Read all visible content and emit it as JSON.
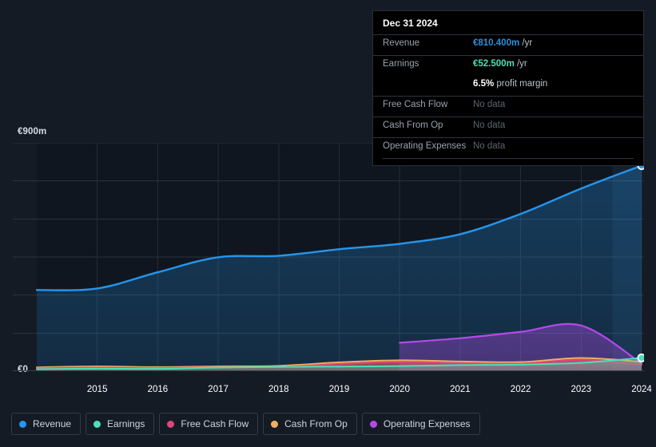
{
  "tooltip": {
    "date": "Dec 31 2024",
    "rows": [
      {
        "key": "Revenue",
        "value": "€810.400m",
        "unit": "/yr",
        "color": "#2d8fdd",
        "nodata": false
      },
      {
        "key": "Earnings",
        "value": "€52.500m",
        "unit": "/yr",
        "color": "#4ae0b8",
        "nodata": false
      },
      {
        "key": "",
        "value": "6.5%",
        "unit": "profit margin",
        "color": "#ffffff",
        "nodata": false
      },
      {
        "key": "Free Cash Flow",
        "value": "No data",
        "unit": "",
        "color": "#5d646e",
        "nodata": true
      },
      {
        "key": "Cash From Op",
        "value": "No data",
        "unit": "",
        "color": "#5d646e",
        "nodata": true
      },
      {
        "key": "Operating Expenses",
        "value": "No data",
        "unit": "",
        "color": "#5d646e",
        "nodata": true
      }
    ]
  },
  "axis": {
    "y_top_label": "€900m",
    "y_bottom_label": "€0"
  },
  "legend": [
    {
      "label": "Revenue",
      "color": "#2496ed"
    },
    {
      "label": "Earnings",
      "color": "#4ae0b8"
    },
    {
      "label": "Free Cash Flow",
      "color": "#e0457b"
    },
    {
      "label": "Cash From Op",
      "color": "#f0b05c"
    },
    {
      "label": "Operating Expenses",
      "color": "#b44ae8"
    }
  ],
  "chart_data": {
    "type": "area",
    "title": "",
    "xlabel": "",
    "ylabel": "",
    "currency": "EUR",
    "unit": "millions",
    "ylim": [
      0,
      900
    ],
    "ytick_labels": [
      "€0",
      "€900m"
    ],
    "grid": true,
    "legend_position": "bottom-left",
    "x": [
      2014.3,
      2015,
      2016,
      2017,
      2018,
      2019,
      2020,
      2021,
      2022,
      2023,
      2024
    ],
    "categories": [
      "2015",
      "2016",
      "2017",
      "2018",
      "2019",
      "2020",
      "2021",
      "2022",
      "2023",
      "2024"
    ],
    "series": [
      {
        "name": "Revenue",
        "color": "#2496ed",
        "values": [
          320,
          326,
          390,
          449,
          455,
          481,
          502,
          540,
          620,
          720,
          810.4
        ]
      },
      {
        "name": "Earnings",
        "color": "#4ae0b8",
        "values": [
          8,
          10,
          9,
          14,
          17,
          18,
          20,
          24,
          26,
          33,
          52.5
        ]
      },
      {
        "name": "Free Cash Flow",
        "color": "#e0457b",
        "values": [
          11,
          14,
          12,
          15,
          17,
          28,
          36,
          32,
          30,
          44,
          26
        ]
      },
      {
        "name": "Cash From Op",
        "color": "#f0b05c",
        "values": [
          15,
          19,
          16,
          19,
          21,
          35,
          43,
          38,
          36,
          52,
          37
        ]
      },
      {
        "name": "Operating Expenses",
        "color": "#b44ae8",
        "values": [
          null,
          null,
          null,
          null,
          null,
          null,
          112,
          130,
          155,
          180,
          30
        ]
      }
    ],
    "highlight_band": {
      "from": "2024",
      "to": "end"
    },
    "endpoint_markers": [
      {
        "series": "Revenue",
        "x": 2024,
        "y": 810.4
      },
      {
        "series": "Earnings",
        "x": 2024,
        "y": 52.5
      }
    ]
  }
}
